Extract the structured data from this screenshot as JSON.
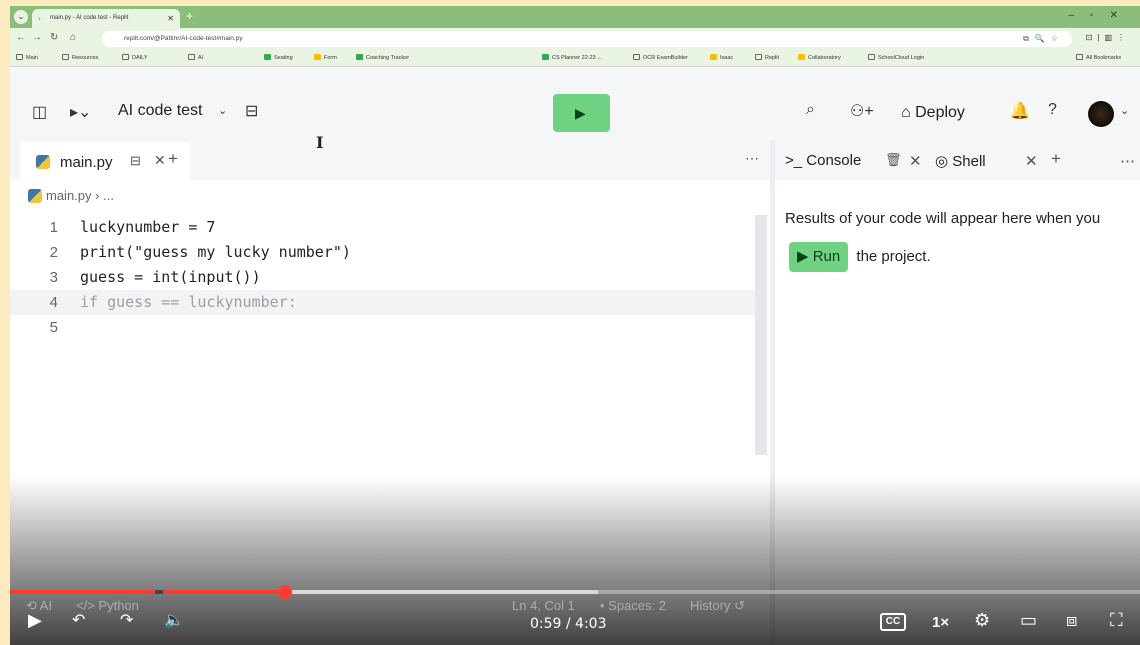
{
  "browser": {
    "tab_title": "main.py - AI code test - Replit",
    "url": "replit.com/@Pattinr/AI-code-test#main.py",
    "bookmarks": [
      "Main",
      "Resources",
      "DAILY",
      "AI",
      "Seating",
      "Form",
      "Coaching Tracker",
      "CS Planner 22-23 ...",
      "OCR ExamBuilder",
      "Isaac",
      "Replit",
      "Collaboratory",
      "SchoolCloud Login"
    ],
    "all_bookmarks": "All Bookmarks"
  },
  "header": {
    "project_name": "AI code test",
    "deploy_label": "Deploy"
  },
  "editor": {
    "tab_label": "main.py",
    "breadcrumb": "main.py",
    "breadcrumb_more": "...",
    "lines": [
      {
        "num": "1",
        "text": "luckynumber = 7"
      },
      {
        "num": "2",
        "text": "print(\"guess my lucky number\")"
      },
      {
        "num": "3",
        "text": "guess = int(input())"
      },
      {
        "num": "4",
        "text": "if guess == luckynumber:"
      },
      {
        "num": "5",
        "text": ""
      }
    ]
  },
  "console": {
    "tab_console": "Console",
    "tab_shell": "Shell",
    "message_before": "Results of your code will appear here when you",
    "run_label": "Run",
    "message_after": "the project."
  },
  "statusbar": {
    "ai": "AI",
    "language": "Python",
    "position": "Ln 4, Col 1",
    "spaces": "Spaces: 2",
    "history": "History"
  },
  "video": {
    "time": "0:59 / 4:03",
    "progress_fraction": 0.243,
    "buffer_fraction": 0.52,
    "speed": "1×",
    "cc": "CC",
    "accent": "#ff3b30"
  }
}
